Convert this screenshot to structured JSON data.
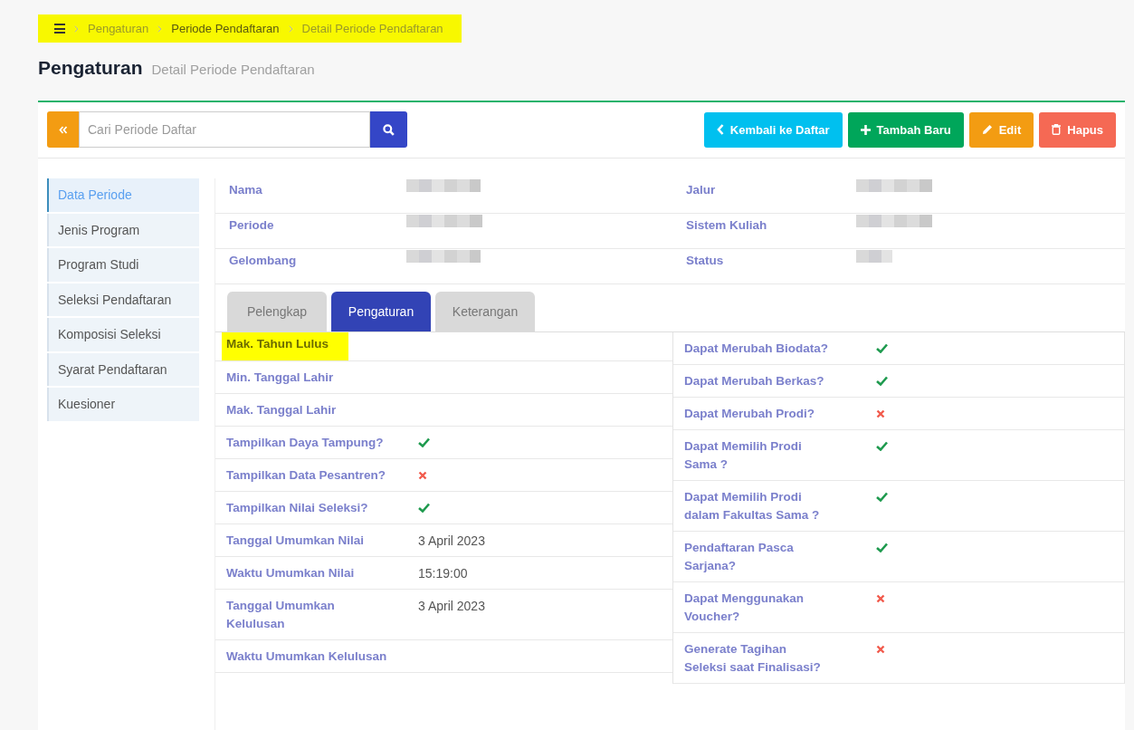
{
  "breadcrumb": {
    "highlighted": true,
    "items": [
      {
        "label": "Pengaturan",
        "emphasized": false
      },
      {
        "label": "Periode Pendaftaran",
        "emphasized": true
      },
      {
        "label": "Detail Periode Pendaftaran",
        "emphasized": false
      }
    ]
  },
  "header": {
    "title": "Pengaturan",
    "subtitle": "Detail Periode Pendaftaran"
  },
  "search": {
    "placeholder": "Cari Periode Daftar"
  },
  "actions": [
    {
      "label": "Kembali ke Daftar",
      "kind": "back"
    },
    {
      "label": "Tambah Baru",
      "kind": "add"
    },
    {
      "label": "Edit",
      "kind": "edit"
    },
    {
      "label": "Hapus",
      "kind": "delete"
    }
  ],
  "sidebar": {
    "items": [
      {
        "label": "Data Periode",
        "selected": true
      },
      {
        "label": "Jenis Program",
        "selected": false
      },
      {
        "label": "Program Studi",
        "selected": false
      },
      {
        "label": "Seleksi Pendaftaran",
        "selected": false
      },
      {
        "label": "Komposisi Seleksi",
        "selected": false
      },
      {
        "label": "Syarat Pendaftaran",
        "selected": false
      },
      {
        "label": "Kuesioner",
        "selected": false
      }
    ]
  },
  "info": {
    "rows": [
      {
        "left": "Nama",
        "right": "Jalur"
      },
      {
        "left": "Periode",
        "right": "Sistem Kuliah"
      },
      {
        "left": "Gelombang",
        "right": "Status"
      }
    ]
  },
  "tabs": [
    {
      "label": "Pelengkap",
      "selected": false
    },
    {
      "label": "Pengaturan",
      "selected": true
    },
    {
      "label": "Keterangan",
      "selected": false
    }
  ],
  "settings_left": [
    {
      "label": "Mak. Tahun Lulus",
      "kind": "empty",
      "highlighted": true
    },
    {
      "label": "Min. Tanggal Lahir",
      "kind": "empty",
      "highlighted": false
    },
    {
      "label": "Mak. Tanggal Lahir",
      "kind": "empty",
      "highlighted": false
    },
    {
      "label": "Tampilkan Daya Tampung?",
      "kind": "flag",
      "on": true,
      "highlighted": false
    },
    {
      "label": "Tampilkan Data Pesantren?",
      "kind": "flag",
      "on": false,
      "highlighted": false
    },
    {
      "label": "Tampilkan Nilai Seleksi?",
      "kind": "flag",
      "on": true,
      "highlighted": false
    },
    {
      "label": "Tanggal Umumkan Nilai",
      "kind": "text",
      "value": "3 April 2023",
      "highlighted": false
    },
    {
      "label": "Waktu Umumkan Nilai",
      "kind": "text",
      "value": "15:19:00",
      "highlighted": false
    },
    {
      "label": "Tanggal Umumkan Kelulusan",
      "kind": "text",
      "value": "3 April 2023",
      "highlighted": false
    },
    {
      "label": "Waktu Umumkan Kelulusan",
      "kind": "empty",
      "highlighted": false
    }
  ],
  "settings_right": [
    {
      "label": "Dapat Merubah Biodata?",
      "kind": "flag",
      "on": true
    },
    {
      "label": "Dapat Merubah Berkas?",
      "kind": "flag",
      "on": true
    },
    {
      "label": "Dapat Merubah Prodi?",
      "kind": "flag",
      "on": false
    },
    {
      "label": "Dapat Memilih Prodi Sama ?",
      "kind": "flag",
      "on": true
    },
    {
      "label": "Dapat Memilih Prodi dalam Fakultas Sama ?",
      "kind": "flag",
      "on": true
    },
    {
      "label": "Pendaftaran Pasca Sarjana?",
      "kind": "flag",
      "on": true
    },
    {
      "label": "Dapat Menggunakan Voucher?",
      "kind": "flag",
      "on": false
    },
    {
      "label": "Generate Tagihan Seleksi saat Finalisasi?",
      "kind": "flag",
      "on": false
    }
  ]
}
